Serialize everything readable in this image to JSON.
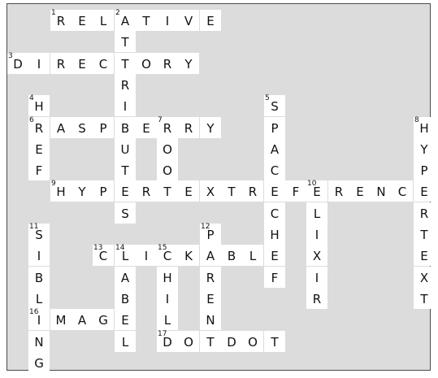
{
  "puzzle": {
    "title": "",
    "colors": {
      "board": "#dcdcdc",
      "cell": "#ffffff",
      "text": "#111111",
      "border": "#4a4a4a"
    },
    "cells": [
      {
        "r": 0,
        "c": 2,
        "ch": "R",
        "n": "1"
      },
      {
        "r": 0,
        "c": 3,
        "ch": "E"
      },
      {
        "r": 0,
        "c": 4,
        "ch": "L"
      },
      {
        "r": 0,
        "c": 5,
        "ch": "A",
        "n": "2"
      },
      {
        "r": 0,
        "c": 6,
        "ch": "T"
      },
      {
        "r": 0,
        "c": 7,
        "ch": "I"
      },
      {
        "r": 0,
        "c": 8,
        "ch": "V"
      },
      {
        "r": 0,
        "c": 9,
        "ch": "E"
      },
      {
        "r": 1,
        "c": 5,
        "ch": "T"
      },
      {
        "r": 2,
        "c": 0,
        "ch": "D",
        "n": "3"
      },
      {
        "r": 2,
        "c": 1,
        "ch": "I"
      },
      {
        "r": 2,
        "c": 2,
        "ch": "R"
      },
      {
        "r": 2,
        "c": 3,
        "ch": "E"
      },
      {
        "r": 2,
        "c": 4,
        "ch": "C"
      },
      {
        "r": 2,
        "c": 5,
        "ch": "T"
      },
      {
        "r": 2,
        "c": 6,
        "ch": "O"
      },
      {
        "r": 2,
        "c": 7,
        "ch": "R"
      },
      {
        "r": 2,
        "c": 8,
        "ch": "Y"
      },
      {
        "r": 3,
        "c": 5,
        "ch": "R"
      },
      {
        "r": 4,
        "c": 1,
        "ch": "H",
        "n": "4"
      },
      {
        "r": 4,
        "c": 5,
        "ch": "I"
      },
      {
        "r": 4,
        "c": 12,
        "ch": "S",
        "n": "5"
      },
      {
        "r": 5,
        "c": 1,
        "ch": "R",
        "n": "6"
      },
      {
        "r": 5,
        "c": 2,
        "ch": "A"
      },
      {
        "r": 5,
        "c": 3,
        "ch": "S"
      },
      {
        "r": 5,
        "c": 4,
        "ch": "P"
      },
      {
        "r": 5,
        "c": 5,
        "ch": "B"
      },
      {
        "r": 5,
        "c": 6,
        "ch": "E"
      },
      {
        "r": 5,
        "c": 7,
        "ch": "R",
        "n": "7"
      },
      {
        "r": 5,
        "c": 8,
        "ch": "R"
      },
      {
        "r": 5,
        "c": 9,
        "ch": "Y"
      },
      {
        "r": 5,
        "c": 12,
        "ch": "P"
      },
      {
        "r": 5,
        "c": 19,
        "ch": "H",
        "n": "8"
      },
      {
        "r": 6,
        "c": 1,
        "ch": "E"
      },
      {
        "r": 6,
        "c": 5,
        "ch": "U"
      },
      {
        "r": 6,
        "c": 7,
        "ch": "O"
      },
      {
        "r": 6,
        "c": 12,
        "ch": "A"
      },
      {
        "r": 6,
        "c": 19,
        "ch": "Y"
      },
      {
        "r": 7,
        "c": 1,
        "ch": "F"
      },
      {
        "r": 7,
        "c": 5,
        "ch": "T"
      },
      {
        "r": 7,
        "c": 7,
        "ch": "O"
      },
      {
        "r": 7,
        "c": 12,
        "ch": "C"
      },
      {
        "r": 7,
        "c": 19,
        "ch": "P"
      },
      {
        "r": 8,
        "c": 2,
        "ch": "H",
        "n": "9"
      },
      {
        "r": 8,
        "c": 3,
        "ch": "Y"
      },
      {
        "r": 8,
        "c": 4,
        "ch": "P"
      },
      {
        "r": 8,
        "c": 5,
        "ch": "E"
      },
      {
        "r": 8,
        "c": 6,
        "ch": "R"
      },
      {
        "r": 8,
        "c": 7,
        "ch": "T"
      },
      {
        "r": 8,
        "c": 8,
        "ch": "E"
      },
      {
        "r": 8,
        "c": 9,
        "ch": "X"
      },
      {
        "r": 8,
        "c": 10,
        "ch": "T"
      },
      {
        "r": 8,
        "c": 11,
        "ch": "R"
      },
      {
        "r": 8,
        "c": 12,
        "ch": "E"
      },
      {
        "r": 8,
        "c": 13,
        "ch": "F"
      },
      {
        "r": 8,
        "c": 14,
        "ch": "E",
        "n": "10"
      },
      {
        "r": 8,
        "c": 15,
        "ch": "R"
      },
      {
        "r": 8,
        "c": 16,
        "ch": "E"
      },
      {
        "r": 8,
        "c": 17,
        "ch": "N"
      },
      {
        "r": 8,
        "c": 18,
        "ch": "C"
      },
      {
        "r": 8,
        "c": 19,
        "ch": "E"
      },
      {
        "r": 9,
        "c": 5,
        "ch": "S"
      },
      {
        "r": 9,
        "c": 12,
        "ch": "C"
      },
      {
        "r": 9,
        "c": 14,
        "ch": "L"
      },
      {
        "r": 9,
        "c": 19,
        "ch": "R"
      },
      {
        "r": 10,
        "c": 1,
        "ch": "S",
        "n": "11"
      },
      {
        "r": 10,
        "c": 9,
        "ch": "P",
        "n": "12"
      },
      {
        "r": 10,
        "c": 12,
        "ch": "H"
      },
      {
        "r": 10,
        "c": 14,
        "ch": "I"
      },
      {
        "r": 10,
        "c": 19,
        "ch": "T"
      },
      {
        "r": 11,
        "c": 1,
        "ch": "I"
      },
      {
        "r": 11,
        "c": 4,
        "ch": "C",
        "n": "13"
      },
      {
        "r": 11,
        "c": 5,
        "ch": "L",
        "n": "14"
      },
      {
        "r": 11,
        "c": 6,
        "ch": "I"
      },
      {
        "r": 11,
        "c": 7,
        "ch": "C",
        "n": "15"
      },
      {
        "r": 11,
        "c": 8,
        "ch": "K"
      },
      {
        "r": 11,
        "c": 9,
        "ch": "A"
      },
      {
        "r": 11,
        "c": 10,
        "ch": "B"
      },
      {
        "r": 11,
        "c": 11,
        "ch": "L"
      },
      {
        "r": 11,
        "c": 12,
        "ch": "E"
      },
      {
        "r": 11,
        "c": 14,
        "ch": "X"
      },
      {
        "r": 11,
        "c": 19,
        "ch": "E"
      },
      {
        "r": 12,
        "c": 1,
        "ch": "B"
      },
      {
        "r": 12,
        "c": 5,
        "ch": "A"
      },
      {
        "r": 12,
        "c": 7,
        "ch": "H"
      },
      {
        "r": 12,
        "c": 9,
        "ch": "R"
      },
      {
        "r": 12,
        "c": 12,
        "ch": "F"
      },
      {
        "r": 12,
        "c": 14,
        "ch": "I"
      },
      {
        "r": 12,
        "c": 19,
        "ch": "X"
      },
      {
        "r": 13,
        "c": 1,
        "ch": "L"
      },
      {
        "r": 13,
        "c": 5,
        "ch": "B"
      },
      {
        "r": 13,
        "c": 7,
        "ch": "I"
      },
      {
        "r": 13,
        "c": 9,
        "ch": "E"
      },
      {
        "r": 13,
        "c": 14,
        "ch": "R"
      },
      {
        "r": 13,
        "c": 19,
        "ch": "T"
      },
      {
        "r": 14,
        "c": 1,
        "ch": "I",
        "n": "16"
      },
      {
        "r": 14,
        "c": 2,
        "ch": "M"
      },
      {
        "r": 14,
        "c": 3,
        "ch": "A"
      },
      {
        "r": 14,
        "c": 4,
        "ch": "G"
      },
      {
        "r": 14,
        "c": 5,
        "ch": "E"
      },
      {
        "r": 14,
        "c": 7,
        "ch": "L"
      },
      {
        "r": 14,
        "c": 9,
        "ch": "N"
      },
      {
        "r": 15,
        "c": 1,
        "ch": "N"
      },
      {
        "r": 15,
        "c": 5,
        "ch": "L"
      },
      {
        "r": 15,
        "c": 7,
        "ch": "D",
        "n": "17"
      },
      {
        "r": 15,
        "c": 8,
        "ch": "O"
      },
      {
        "r": 15,
        "c": 9,
        "ch": "T"
      },
      {
        "r": 15,
        "c": 10,
        "ch": "D"
      },
      {
        "r": 15,
        "c": 11,
        "ch": "O"
      },
      {
        "r": 15,
        "c": 12,
        "ch": "T"
      },
      {
        "r": 16,
        "c": 1,
        "ch": "G"
      }
    ]
  }
}
